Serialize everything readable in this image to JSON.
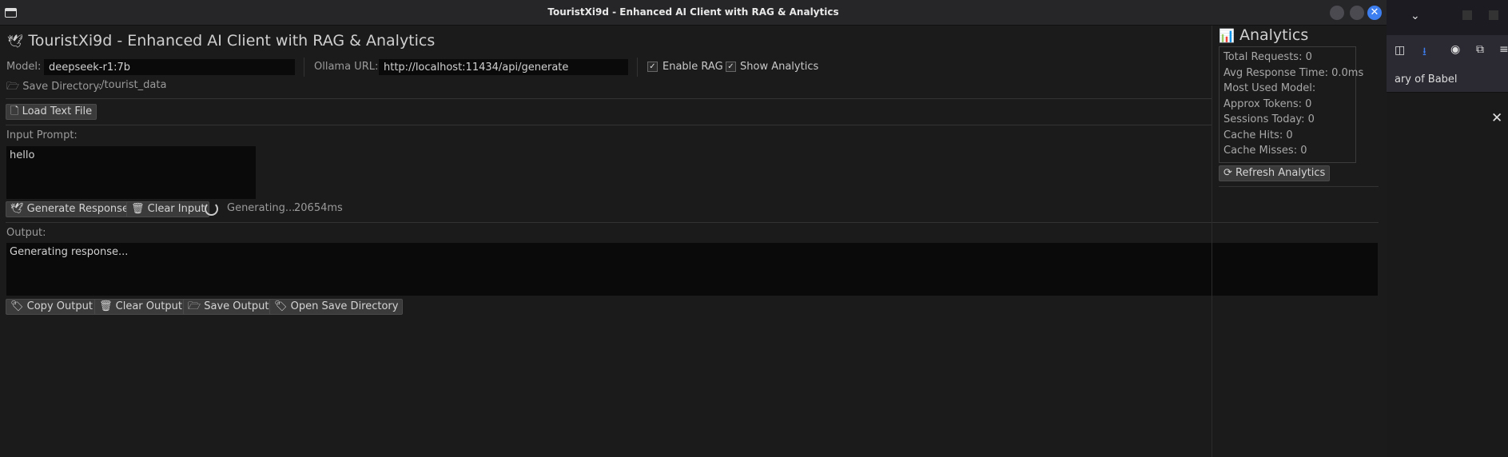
{
  "window": {
    "title": "TouristXi9d - Enhanced AI Client with RAG & Analytics",
    "close_glyph": "✕"
  },
  "app": {
    "heading": "TouristXi9d - Enhanced AI Client with RAG & Analytics",
    "model_label": "Model:",
    "model_value": "deepseek-r1:7b",
    "url_label": "Ollama URL:",
    "url_value": "http://localhost:11434/api/generate",
    "enable_rag_label": "Enable RAG",
    "show_analytics_label": "Show Analytics",
    "save_dir_label": "Save Directory:",
    "save_dir_value": "./tourist_data",
    "load_file_button": "Load Text File",
    "input_label": "Input Prompt:",
    "input_value": "hello",
    "generate_button": "Generate Response",
    "clear_input_button": "Clear Input",
    "status_text": "Generating...",
    "elapsed_text": "20654ms",
    "output_label": "Output:",
    "output_value": "Generating response...",
    "copy_output_button": "Copy Output",
    "clear_output_button": "Clear Output",
    "save_output_button": "Save Output",
    "open_dir_button": "Open Save Directory"
  },
  "analytics": {
    "title": "Analytics",
    "stats": [
      "Total Requests: 0",
      "Avg Response Time: 0.0ms",
      "Most Used Model:",
      "Approx Tokens: 0",
      "Sessions Today: 0",
      "Cache Hits: 0",
      "Cache Misses: 0"
    ],
    "refresh_button": "Refresh Analytics"
  },
  "browser": {
    "bookmark_text": "ary of Babel",
    "close_glyph": "✕"
  },
  "colors": {
    "accent": "#3d7ff0",
    "background": "#1b1b1b",
    "field": "#0a0a0a"
  }
}
